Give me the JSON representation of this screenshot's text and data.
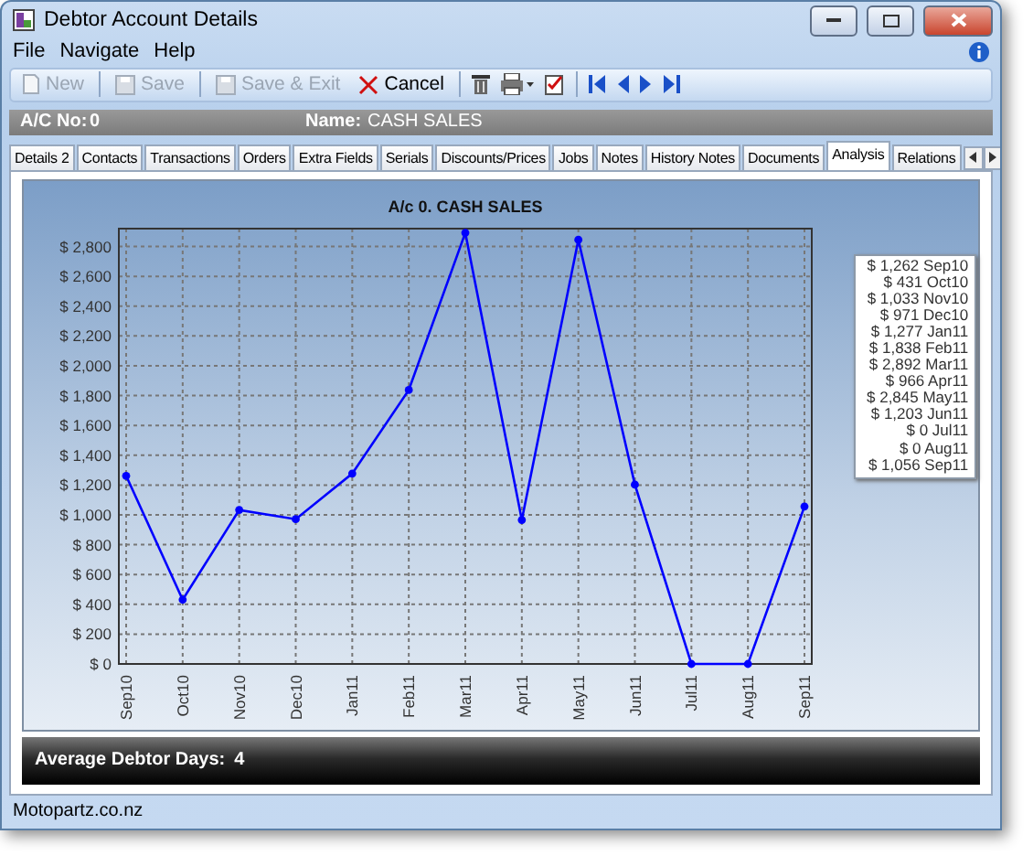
{
  "window": {
    "title": "Debtor Account Details"
  },
  "menu": [
    "File",
    "Navigate",
    "Help"
  ],
  "toolbar": [
    {
      "kind": "button",
      "label": "New",
      "disabled": true
    },
    {
      "kind": "button",
      "label": "Save",
      "disabled": true
    },
    {
      "kind": "button",
      "label": "Save & Exit",
      "disabled": true
    },
    {
      "kind": "button",
      "label": "Cancel",
      "disabled": false
    }
  ],
  "header": {
    "account_label": "A/C No:",
    "account_value": "0",
    "name_label": "Name:",
    "name_value": "CASH SALES"
  },
  "tabs": [
    {
      "label": "Details 2",
      "selected": false
    },
    {
      "label": "Contacts",
      "selected": false
    },
    {
      "label": "Transactions",
      "selected": false
    },
    {
      "label": "Orders",
      "selected": false
    },
    {
      "label": "Extra Fields",
      "selected": false
    },
    {
      "label": "Serials",
      "selected": false
    },
    {
      "label": "Discounts/Prices",
      "selected": false
    },
    {
      "label": "Jobs",
      "selected": false
    },
    {
      "label": "Notes",
      "selected": false
    },
    {
      "label": "History Notes",
      "selected": false
    },
    {
      "label": "Documents",
      "selected": false
    },
    {
      "label": "Analysis",
      "selected": true
    },
    {
      "label": "Relations",
      "selected": false
    }
  ],
  "chart": {
    "chart_data": {
      "type": "line",
      "title": "A/c 0. CASH SALES",
      "categories": [
        "Sep10",
        "Oct10",
        "Nov10",
        "Dec10",
        "Jan11",
        "Feb11",
        "Mar11",
        "Apr11",
        "May11",
        "Jun11",
        "Jul11",
        "Aug11",
        "Sep11"
      ],
      "grid": true,
      "series": [
        {
          "color": "#0000ff",
          "marker": true,
          "values": [
            1262,
            431,
            1033,
            971,
            1277,
            1838,
            2892,
            966,
            2845,
            1203,
            0,
            0,
            1056
          ]
        }
      ],
      "ylim": [
        0,
        2920
      ],
      "yticks": [
        {
          "value": 0,
          "label": "$ 0"
        },
        {
          "value": 200,
          "label": "$ 200"
        },
        {
          "value": 400,
          "label": "$ 400"
        },
        {
          "value": 600,
          "label": "$ 600"
        },
        {
          "value": 800,
          "label": "$ 800"
        },
        {
          "value": 1000,
          "label": "$ 1,000"
        },
        {
          "value": 1200,
          "label": "$ 1,200"
        },
        {
          "value": 1400,
          "label": "$ 1,400"
        },
        {
          "value": 1600,
          "label": "$ 1,600"
        },
        {
          "value": 1800,
          "label": "$ 1,800"
        },
        {
          "value": 2000,
          "label": "$ 2,000"
        },
        {
          "value": 2200,
          "label": "$ 2,200"
        },
        {
          "value": 2400,
          "label": "$ 2,400"
        },
        {
          "value": 2600,
          "label": "$ 2,600"
        },
        {
          "value": 2800,
          "label": "$ 2,800"
        }
      ]
    },
    "legend": [
      "$ 1,262 Sep10",
      "$ 431 Oct10",
      "$ 1,033 Nov10",
      "$ 971 Dec10",
      "$ 1,277 Jan11",
      "$ 1,838 Feb11",
      "$ 2,892 Mar11",
      "$ 966 Apr11",
      "$ 2,845 May11",
      "$ 1,203 Jun11",
      "$ 0 Jul11",
      "$ 0 Aug11",
      "$ 1,056 Sep11"
    ]
  },
  "summary": {
    "label": "Average Debtor Days:",
    "value": "4"
  },
  "status_bar": "Motopartz.co.nz"
}
